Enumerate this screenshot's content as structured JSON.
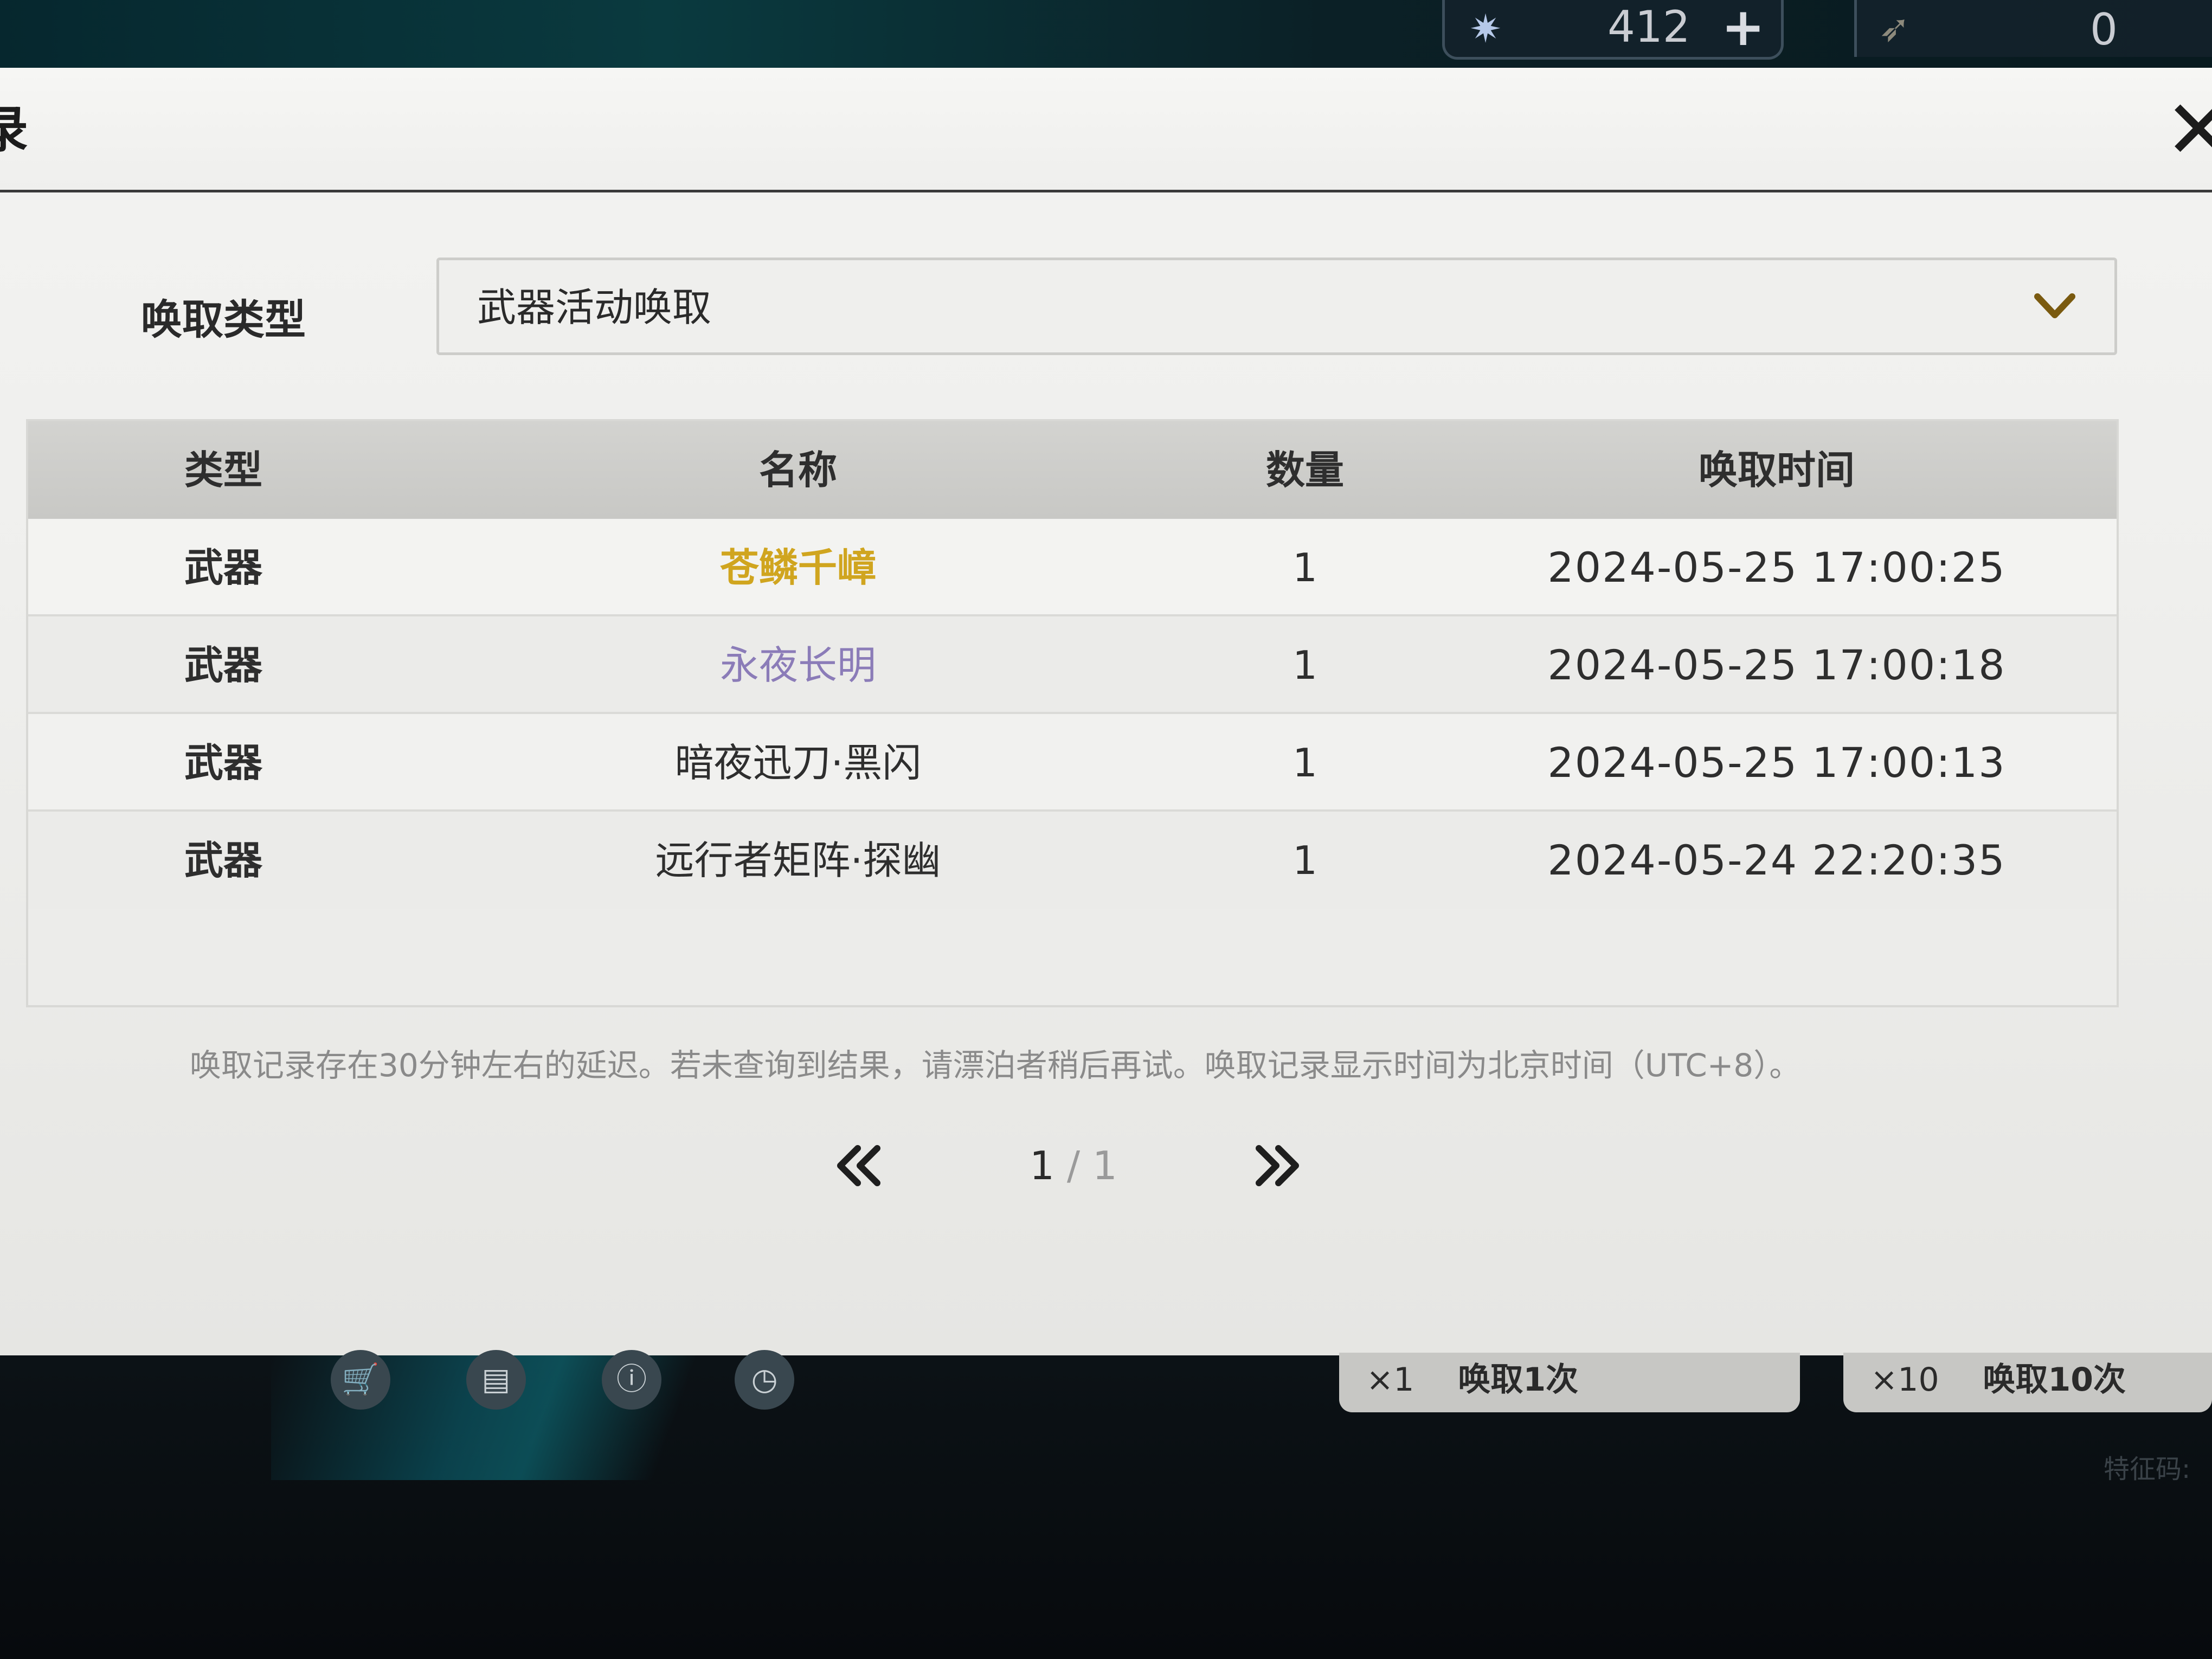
{
  "hud": {
    "currency_primary": {
      "icon": "star-crystal-icon",
      "amount": "412",
      "plus_label": "+"
    },
    "currency_secondary": {
      "icon": "feather-icon",
      "amount": "0"
    },
    "bottom_icons": [
      "cart-icon",
      "record-icon",
      "info-icon",
      "clock-icon"
    ],
    "pull_one": {
      "count": "×1",
      "label": "唤取1次"
    },
    "pull_ten": {
      "count": "×10",
      "label": "唤取10次"
    },
    "feature_code": "特征码:"
  },
  "modal": {
    "title": "录",
    "close_icon": "close-icon",
    "filter": {
      "label": "唤取类型",
      "selected": "武器活动唤取"
    },
    "table": {
      "headers": [
        "类型",
        "名称",
        "数量",
        "唤取时间"
      ],
      "rows": [
        {
          "type": "武器",
          "name": "苍鳞千嶂",
          "qty": "1",
          "time": "2024-05-25 17:00:25",
          "rarity_color": "#d0a51f"
        },
        {
          "type": "武器",
          "name": "永夜长明",
          "qty": "1",
          "time": "2024-05-25 17:00:18",
          "rarity_color": "#8b7cb8"
        },
        {
          "type": "武器",
          "name": "暗夜迅刀·黑闪",
          "qty": "1",
          "time": "2024-05-25 17:00:13",
          "rarity_color": "#2e2e2e"
        },
        {
          "type": "武器",
          "name": "远行者矩阵·探幽",
          "qty": "1",
          "time": "2024-05-24 22:20:35",
          "rarity_color": "#2e2e2e"
        }
      ]
    },
    "notice": "唤取记录存在30分钟左右的延迟。若未查询到结果，请漂泊者稍后再试。唤取记录显示时间为北京时间（UTC+8）。",
    "pagination": {
      "current": "1",
      "separator": "/",
      "total": "1"
    }
  }
}
